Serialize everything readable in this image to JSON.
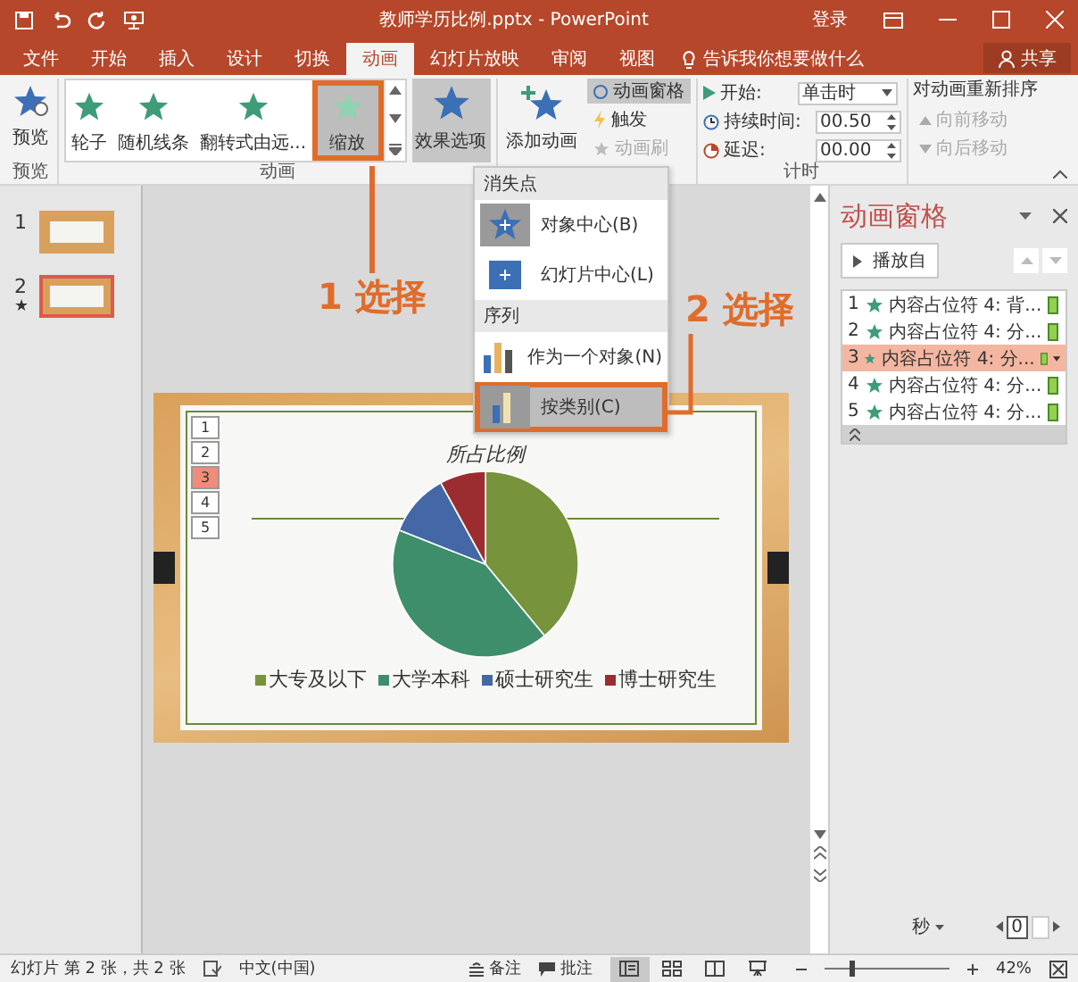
{
  "title_bar": {
    "title": "教师学历比例.pptx - PowerPoint",
    "login": "登录"
  },
  "tabs": [
    {
      "label": "文件",
      "selected": false
    },
    {
      "label": "开始",
      "selected": false
    },
    {
      "label": "插入",
      "selected": false
    },
    {
      "label": "设计",
      "selected": false
    },
    {
      "label": "切换",
      "selected": false
    },
    {
      "label": "动画",
      "selected": true
    },
    {
      "label": "幻灯片放映",
      "selected": false
    },
    {
      "label": "审阅",
      "selected": false
    },
    {
      "label": "视图",
      "selected": false
    }
  ],
  "tell_me": {
    "placeholder": "告诉我你想要做什么"
  },
  "share": "共享",
  "ribbon": {
    "preview": {
      "label": "预览",
      "group": "预览"
    },
    "gallery": {
      "group": "动画",
      "items": [
        {
          "label": "轮子",
          "selected": false,
          "framed": false
        },
        {
          "label": "随机线条",
          "selected": false,
          "framed": false
        },
        {
          "label": "翻转式由远...",
          "selected": false,
          "framed": false
        },
        {
          "label": "缩放",
          "selected": true,
          "framed": true
        }
      ]
    },
    "effect_options": {
      "label": "效果选项",
      "pressed": true
    },
    "add_animation": "添加动画",
    "animation_pane_button": {
      "label": "动画窗格",
      "pressed": true
    },
    "trigger": {
      "label": "触发",
      "disabled": false
    },
    "painter": {
      "label": "动画刷",
      "disabled": true
    },
    "timing": {
      "group": "计时",
      "start_label": "开始:",
      "start_value": "单击时",
      "duration_label": "持续时间:",
      "duration_value": "00.50",
      "delay_label": "延迟:",
      "delay_value": "00.00"
    },
    "reorder": {
      "title": "对动画重新排序",
      "items": [
        {
          "label": "向前移动",
          "disabled": true
        },
        {
          "label": "向后移动",
          "disabled": true
        }
      ]
    }
  },
  "slides_pane": [
    {
      "number": "1",
      "selected": false
    },
    {
      "number": "2",
      "mark": "★",
      "selected": true
    }
  ],
  "effect_menu": {
    "sections": [
      {
        "heading": "消失点",
        "items": [
          {
            "label": "对象中心(B)",
            "kind": "star",
            "selected": true,
            "framed": false
          },
          {
            "label": "幻灯片中心(L)",
            "kind": "square",
            "selected": false,
            "framed": false
          }
        ]
      },
      {
        "heading": "序列",
        "items": [
          {
            "label": "作为一个对象(N)",
            "kind": "bars",
            "selected": false,
            "framed": false
          },
          {
            "label": "按类别(C)",
            "kind": "category",
            "selected": true,
            "framed": true
          }
        ]
      }
    ]
  },
  "annotations": [
    {
      "number": "1",
      "text": "选择"
    },
    {
      "number": "2",
      "text": "选择"
    }
  ],
  "slide": {
    "title": "所占比例",
    "tags": [
      {
        "label": "1",
        "selected": false
      },
      {
        "label": "2",
        "selected": false
      },
      {
        "label": "3",
        "selected": true
      },
      {
        "label": "4",
        "selected": false
      },
      {
        "label": "5",
        "selected": false
      }
    ],
    "legend": [
      {
        "label": "大专及以下",
        "color": "#77933c"
      },
      {
        "label": "大学本科",
        "color": "#3e8e6b"
      },
      {
        "label": "硕士研究生",
        "color": "#4468a6"
      },
      {
        "label": "博士研究生",
        "color": "#9b2d30"
      }
    ]
  },
  "animation_pane": {
    "title": "动画窗格",
    "play": "播放自",
    "items": [
      {
        "number": "1",
        "text": "内容占位符 4: 背...",
        "selected": false
      },
      {
        "number": "2",
        "text": "内容占位符 4: 分...",
        "selected": false
      },
      {
        "number": "3",
        "text": "内容占位符 4: 分...",
        "selected": true
      },
      {
        "number": "4",
        "text": "内容占位符 4: 分...",
        "selected": false
      },
      {
        "number": "5",
        "text": "内容占位符 4: 分...",
        "selected": false
      }
    ],
    "unit": "秒",
    "timeline_value": "0"
  },
  "status_bar": {
    "slide_info": "幻灯片 第 2 张，共 2 张",
    "language": "中文(中国)",
    "notes": "备注",
    "comments": "批注",
    "views": [
      {
        "kind": "normal",
        "selected": true
      },
      {
        "kind": "sorter",
        "selected": false
      },
      {
        "kind": "reading",
        "selected": false
      },
      {
        "kind": "show",
        "selected": false
      }
    ],
    "zoom_slider": {
      "level": 0.22
    },
    "zoom": "42%"
  }
}
